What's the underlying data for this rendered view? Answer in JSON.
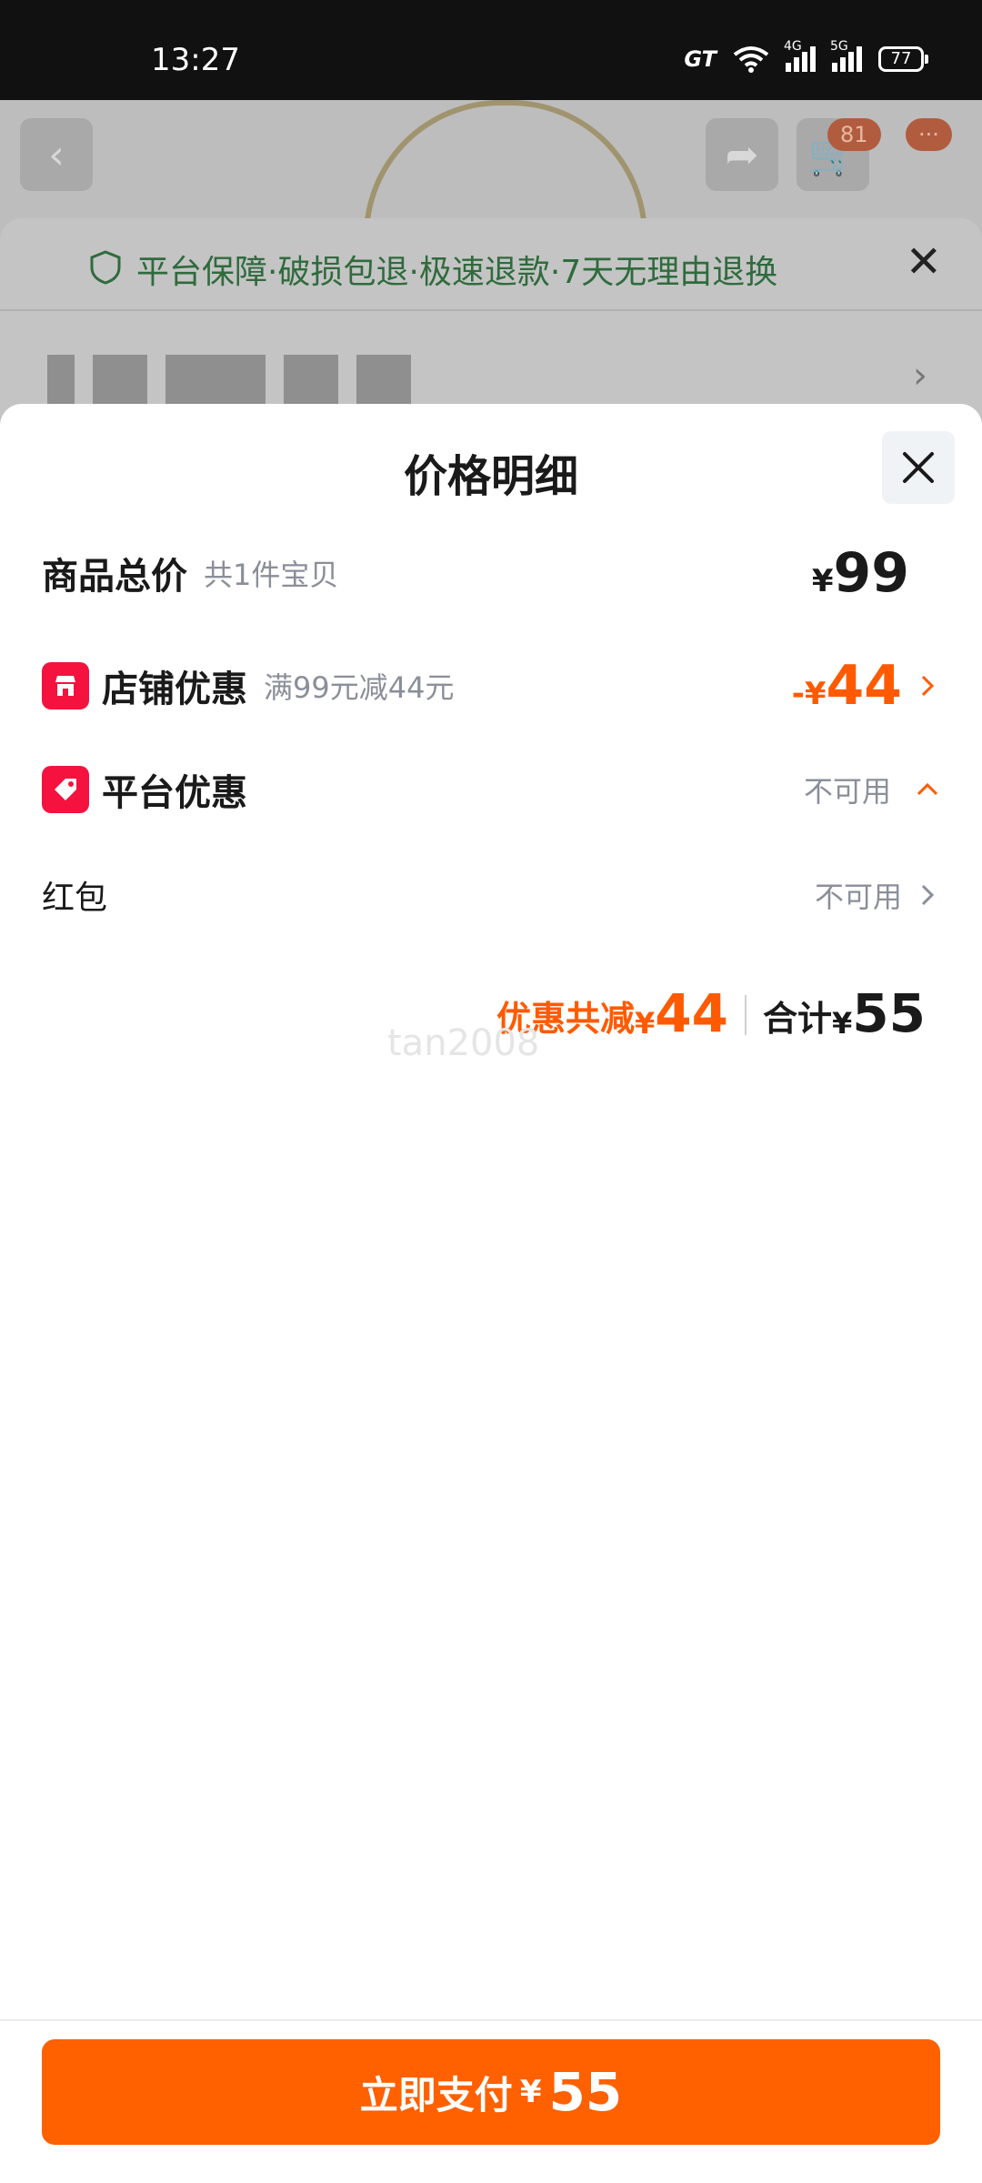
{
  "status_bar": {
    "time": "13:27",
    "network_badge": "GT",
    "signal1_label": "4G",
    "signal2_label": "5G",
    "battery": "77"
  },
  "background": {
    "cart_badge": "81",
    "more_badge": "···",
    "guarantee_text": "平台保障·破损包退·极速退款·7天无理由退换"
  },
  "modal": {
    "title": "价格明细",
    "rows": {
      "total": {
        "label": "商品总价",
        "sub": "共1件宝贝",
        "currency": "¥",
        "amount": "99"
      },
      "store": {
        "label": "店铺优惠",
        "sub": "满99元减44元",
        "prefix": "-",
        "currency": "¥",
        "amount": "44"
      },
      "platform": {
        "label": "平台优惠",
        "status": "不可用"
      },
      "redpacket": {
        "label": "红包",
        "status": "不可用"
      }
    },
    "summary": {
      "discount_label": "优惠共减",
      "discount_currency": "¥",
      "discount_amount": "44",
      "total_label": "合计",
      "total_currency": "¥",
      "total_amount": "55"
    },
    "watermark": "tan2008",
    "pay_button": {
      "label": "立即支付",
      "currency": "¥",
      "amount": "55"
    }
  },
  "colors": {
    "accent_orange": "#ff5a00",
    "pay_button": "#ff6000",
    "icon_red": "#f5123e",
    "muted_text": "#8a8f99"
  },
  "icons": [
    "gt-icon",
    "wifi-icon",
    "signal-icon",
    "battery-icon",
    "back-icon",
    "share-icon",
    "cart-icon",
    "more-icon",
    "shield-icon",
    "close-icon",
    "store-icon",
    "tag-icon",
    "chevron-right-icon",
    "chevron-up-icon"
  ]
}
